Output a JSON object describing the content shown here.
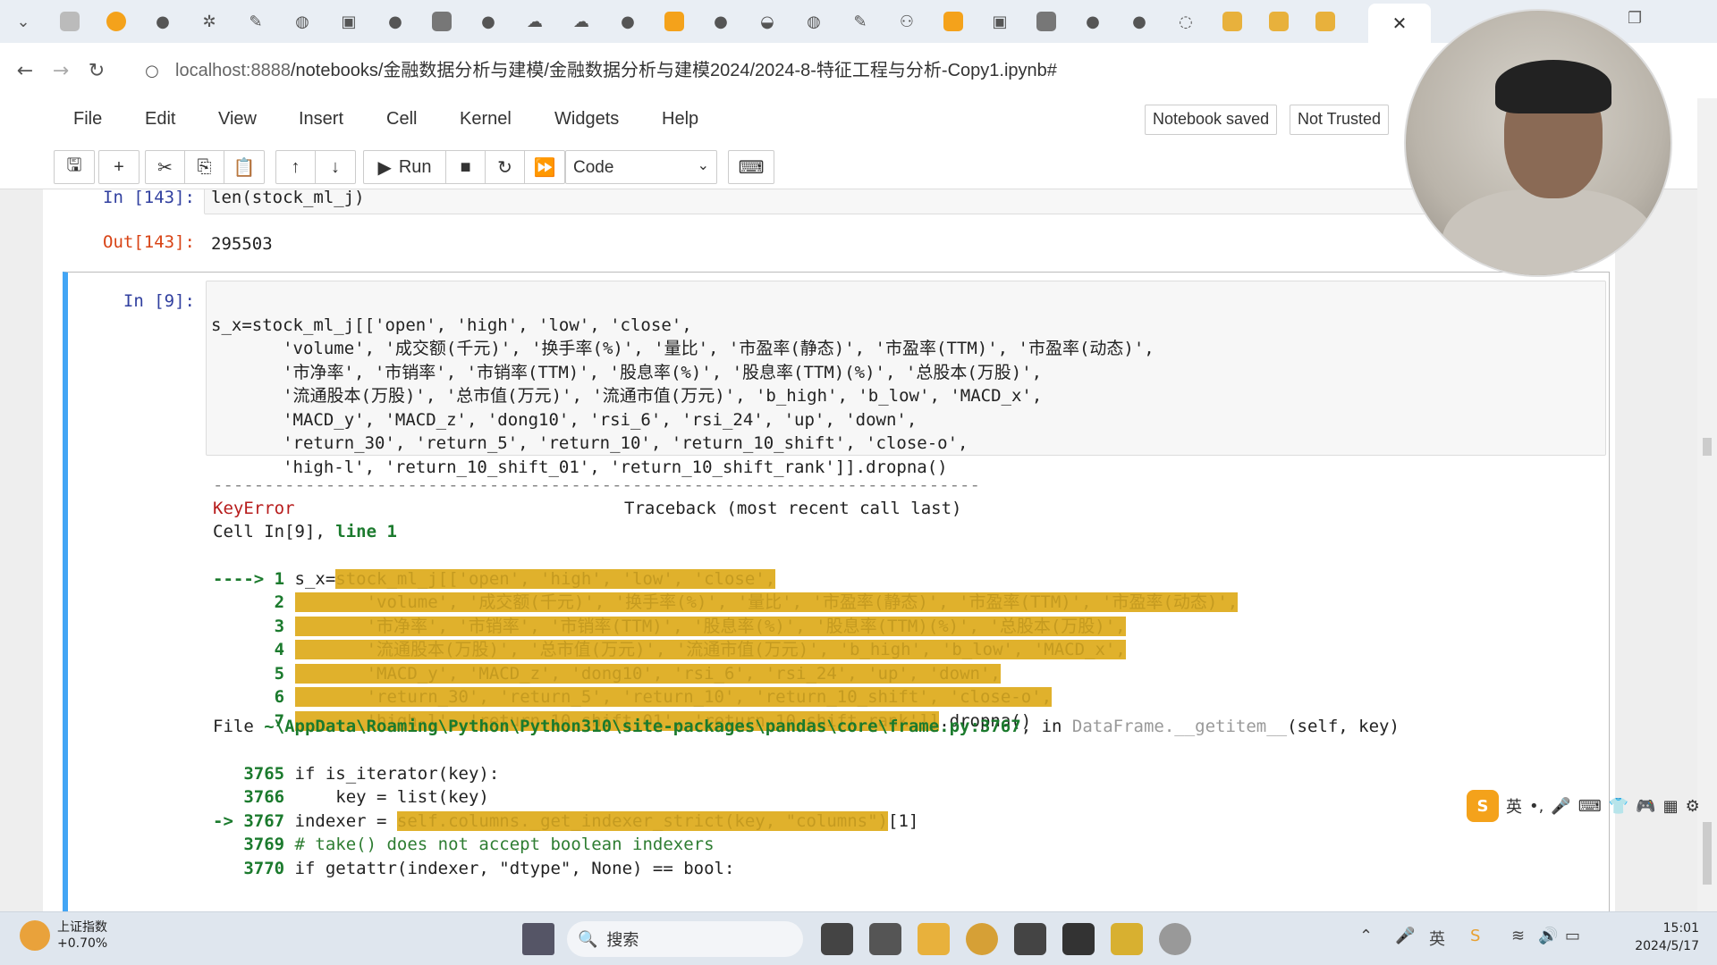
{
  "browser": {
    "url_host": "localhost:8888",
    "url_path": "/notebooks/金融数据分析与建模/金融数据分析与建模2024/2024-8-特征工程与分析-Copy1.ipynb#",
    "close_tab": "✕"
  },
  "menu": [
    "File",
    "Edit",
    "View",
    "Insert",
    "Cell",
    "Kernel",
    "Widgets",
    "Help"
  ],
  "status": {
    "saved": "Notebook saved",
    "trusted": "Not Trusted"
  },
  "toolbar": {
    "run_label": "Run",
    "cell_type": "Code"
  },
  "cells": {
    "c143": {
      "in_prompt": "In  [143]:",
      "code": "len(stock_ml_j)",
      "out_prompt": "Out[143]:",
      "output": "295503"
    },
    "c9": {
      "in_prompt": "In  [9]:",
      "lines": [
        "s_x=stock_ml_j[['open', 'high', 'low', 'close',",
        "       'volume', '成交额(千元)', '换手率(%)', '量比', '市盈率(静态)', '市盈率(TTM)', '市盈率(动态)',",
        "       '市净率', '市销率', '市销率(TTM)', '股息率(%)', '股息率(TTM)(%)', '总股本(万股)',",
        "       '流通股本(万股)', '总市值(万元)', '流通市值(万元)', 'b_high', 'b_low', 'MACD_x',",
        "       'MACD_y', 'MACD_z', 'dong10', 'rsi_6', 'rsi_24', 'up', 'down',",
        "       'return_30', 'return_5', 'return_10', 'return_10_shift', 'close-o',",
        "       'high-l', 'return_10_shift_01', 'return_10_shift_rank']].dropna()"
      ]
    }
  },
  "error": {
    "divider": "---------------------------------------------------------------------------",
    "name": "KeyError",
    "traceback": "Traceback (most recent call last)",
    "cell_ref_a": "Cell In[9], ",
    "cell_ref_b": "line 1",
    "tb_lines": [
      {
        "num": "----> 1",
        "pre": " s_x=",
        "hl": "stock_ml_j[['open', 'high', 'low', 'close',",
        "post": ""
      },
      {
        "num": "      2",
        "pre": " ",
        "hl": "       'volume', '成交额(千元)', '换手率(%)', '量比', '市盈率(静态)', '市盈率(TTM)', '市盈率(动态)',",
        "post": ""
      },
      {
        "num": "      3",
        "pre": " ",
        "hl": "       '市净率', '市销率', '市销率(TTM)', '股息率(%)', '股息率(TTM)(%)', '总股本(万股)',",
        "post": ""
      },
      {
        "num": "      4",
        "pre": " ",
        "hl": "       '流通股本(万股)', '总市值(万元)', '流通市值(万元)', 'b_high', 'b_low', 'MACD_x',",
        "post": ""
      },
      {
        "num": "      5",
        "pre": " ",
        "hl": "       'MACD_y', 'MACD_z', 'dong10', 'rsi_6', 'rsi_24', 'up', 'down',",
        "post": ""
      },
      {
        "num": "      6",
        "pre": " ",
        "hl": "       'return_30', 'return_5', 'return_10', 'return_10_shift', 'close-o',",
        "post": ""
      },
      {
        "num": "      7",
        "pre": " ",
        "hl": "       'high-l', 'return_10_shift_01', 'return_10_shift_rank']]",
        "post": ".dropna()"
      }
    ],
    "file_line_a": "File ",
    "file_line_b": "~\\AppData\\Roaming\\Python\\Python310\\site-packages\\pandas\\core\\frame.py:3767",
    "file_line_c": ", in ",
    "file_line_d": "DataFrame.__getitem__",
    "file_line_e": "(self, key)",
    "src": [
      {
        "num": "   3765",
        "text": " if is_iterator(key):"
      },
      {
        "num": "   3766",
        "text": "     key = list(key)"
      },
      {
        "num": "-> 3767",
        "text": " indexer = ",
        "hl": "self.columns._get_indexer_strict(key, \"columns\")",
        "post": "[1]"
      },
      {
        "num": "   3769",
        "text": " # take() does not accept boolean indexers"
      },
      {
        "num": "   3770",
        "text": " if getattr(indexer, \"dtype\", None) == bool:"
      }
    ]
  },
  "ime": {
    "lang": "英"
  },
  "taskbar": {
    "stock_name": "上证指数",
    "stock_change": "+0.70%",
    "search_placeholder": "搜索",
    "time": "15:01",
    "date": "2024/5/17"
  },
  "colors": {
    "accent": "#42a5f5",
    "highlight": "#e0b12c",
    "prompt_in": "#303f9f",
    "prompt_out": "#d84315"
  }
}
